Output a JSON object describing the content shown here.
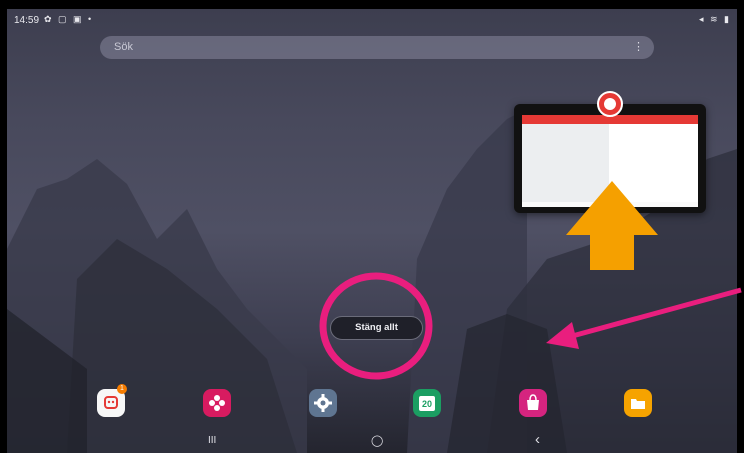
{
  "status_bar": {
    "time": "14:59",
    "left_icons": "✿ ▢ ▣ •",
    "right_icons": "◂ ≋ ▮"
  },
  "search": {
    "placeholder": "Sök",
    "menu_glyph": "⋮"
  },
  "recent_app": {
    "icon": "red-circle-app-icon",
    "header_color": "#e53935"
  },
  "close_all_label": "Stäng allt",
  "dock": [
    {
      "icon": "chat-app-icon",
      "color": "#f7f7f7",
      "badge": "1"
    },
    {
      "icon": "flower-app-icon",
      "color": "#d81b60"
    },
    {
      "icon": "settings-gear-icon",
      "color": "#5f7591"
    },
    {
      "icon": "calendar-icon",
      "color": "#1b9e62",
      "text": "20"
    },
    {
      "icon": "store-bag-icon",
      "color": "#d5247f"
    },
    {
      "icon": "folder-icon",
      "color": "#f6a300"
    }
  ],
  "nav": {
    "recents": "III",
    "home": "◯",
    "back": "‹"
  },
  "annotation_colors": {
    "arrow_up": "#f5a000",
    "highlight": "#e91e7e"
  }
}
